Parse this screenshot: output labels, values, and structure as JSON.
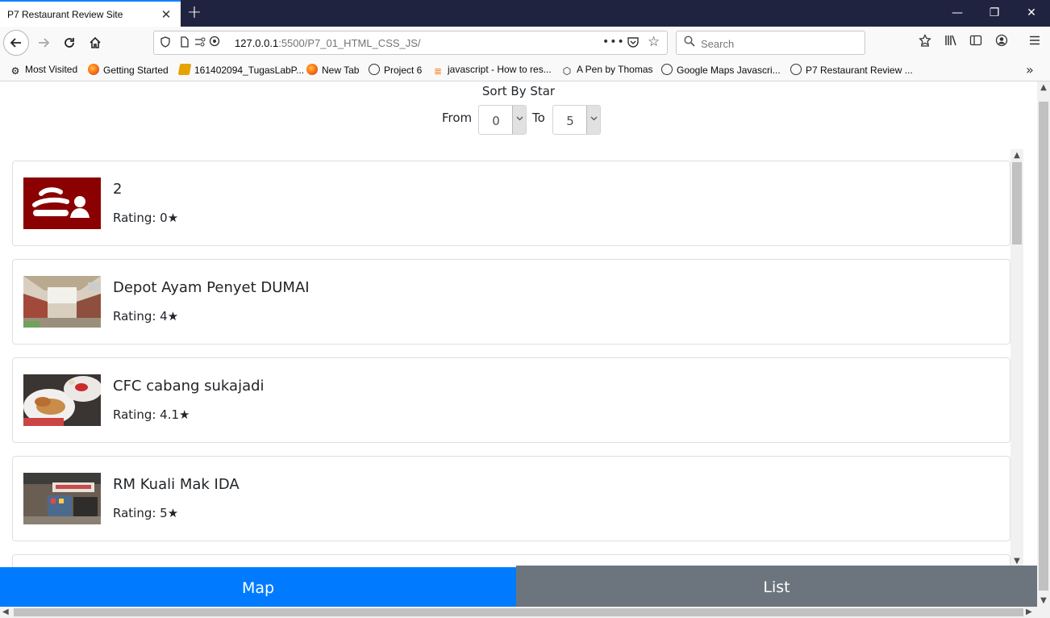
{
  "browser": {
    "tab_title": "P7 Restaurant Review Site",
    "tab_close": "✕",
    "new_tab": "+",
    "window": {
      "minimize": "—",
      "maximize": "❐",
      "close": "✕"
    },
    "url": {
      "host": "127.0.0.1",
      "path": ":5500/P7_01_HTML_CSS_JS/"
    },
    "search_placeholder": "Search",
    "icons": {
      "back": "back-arrow-icon",
      "forward": "forward-arrow-icon",
      "reload": "reload-icon",
      "home": "home-icon",
      "shield": "tracking-shield-icon",
      "page": "page-icon",
      "permissions": "permissions-icon",
      "site-info": "site-info-icon",
      "more": "page-actions-icon",
      "pocket": "pocket-icon",
      "star": "bookmark-star-icon",
      "search": "search-icon",
      "bookmarks": "bookmarks-icon",
      "library": "library-icon",
      "sidebar": "sidebar-icon",
      "account": "account-icon",
      "menu": "hamburger-menu-icon"
    },
    "bookmarks": [
      {
        "label": "Most Visited",
        "icon": "gear-icon"
      },
      {
        "label": "Getting Started",
        "icon": "firefox-icon"
      },
      {
        "label": "161402094_TugasLabP...",
        "icon": "document-icon"
      },
      {
        "label": "New Tab",
        "icon": "firefox-icon"
      },
      {
        "label": "Project 6",
        "icon": "globe-icon"
      },
      {
        "label": "javascript - How to res...",
        "icon": "stackoverflow-icon"
      },
      {
        "label": "A Pen by Thomas",
        "icon": "codepen-icon"
      },
      {
        "label": "Google Maps Javascri...",
        "icon": "globe-icon"
      },
      {
        "label": "P7 Restaurant Review ...",
        "icon": "globe-icon"
      }
    ],
    "bookmarks_overflow": "»"
  },
  "page": {
    "sort": {
      "title": "Sort By Star",
      "from_label": "From",
      "from_value": "0",
      "to_label": "To",
      "to_value": "5",
      "dropdown_arrow": "⌄"
    },
    "restaurants": [
      {
        "name": "2",
        "rating": "Rating: 0★",
        "thumb": "placeholder-restaurant-icon"
      },
      {
        "name": "Depot Ayam Penyet DUMAI",
        "rating": "Rating: 4★",
        "thumb": "restaurant-photo"
      },
      {
        "name": "CFC cabang sukajadi",
        "rating": "Rating: 4.1★",
        "thumb": "restaurant-photo"
      },
      {
        "name": "RM Kuali Mak IDA",
        "rating": "Rating: 5★",
        "thumb": "restaurant-photo"
      }
    ],
    "buttons": {
      "map": "Map",
      "list": "List"
    },
    "colors": {
      "map_button": "#007bff",
      "list_button": "#6c757d",
      "placeholder_thumb": "#8b0000"
    }
  }
}
